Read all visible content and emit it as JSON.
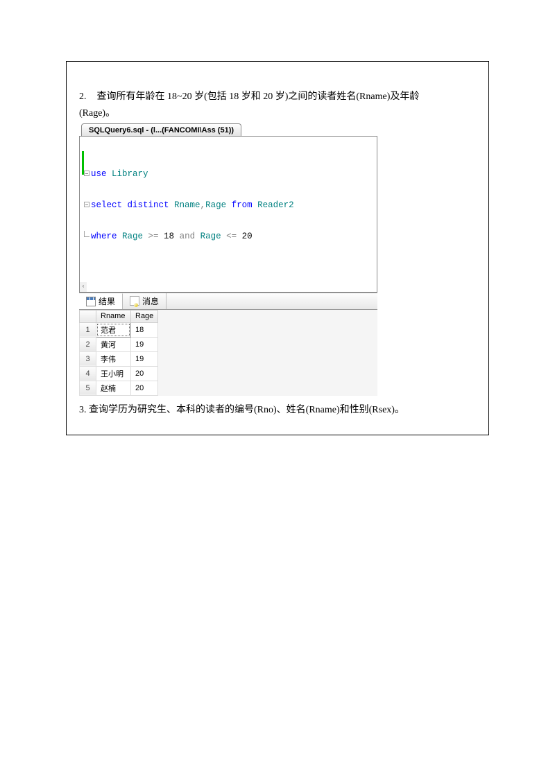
{
  "question2": {
    "num": "2.",
    "text_line1": "查询所有年龄在 18~20 岁(包括 18 岁和 20 岁)之间的读者姓名(Rname)及年龄",
    "text_line2": "(Rage)。"
  },
  "editor": {
    "tab_title": "SQLQuery6.sql - (l...(FANCOMI\\Ass (51))",
    "code": {
      "l1_use": "use",
      "l1_lib": " Library",
      "l2_select": "select",
      "l2_distinct": " distinct ",
      "l2_cols": "Rname",
      "l2_comma": ",",
      "l2_cols2": "Rage ",
      "l2_from": "from",
      "l2_table": " Reader2",
      "l3_where": "where",
      "l3_c1": " Rage ",
      "l3_op1": ">=",
      "l3_v1": " 18 ",
      "l3_and": "and",
      "l3_c2": " Rage ",
      "l3_op2": "<=",
      "l3_v2": " 20"
    },
    "scroll_left": "‹"
  },
  "results": {
    "tab_results": "结果",
    "tab_messages": "消息",
    "headers": {
      "corner": "",
      "rname": "Rname",
      "rage": "Rage"
    },
    "rows": [
      {
        "n": "1",
        "rname": "范君",
        "rage": "18"
      },
      {
        "n": "2",
        "rname": "黄河",
        "rage": "19"
      },
      {
        "n": "3",
        "rname": "李伟",
        "rage": "19"
      },
      {
        "n": "4",
        "rname": "王小明",
        "rage": "20"
      },
      {
        "n": "5",
        "rname": "赵楠",
        "rage": "20"
      }
    ]
  },
  "question3": {
    "num": "3.",
    "text": "查询学历为研究生、本科的读者的编号(Rno)、姓名(Rname)和性别(Rsex)。"
  }
}
